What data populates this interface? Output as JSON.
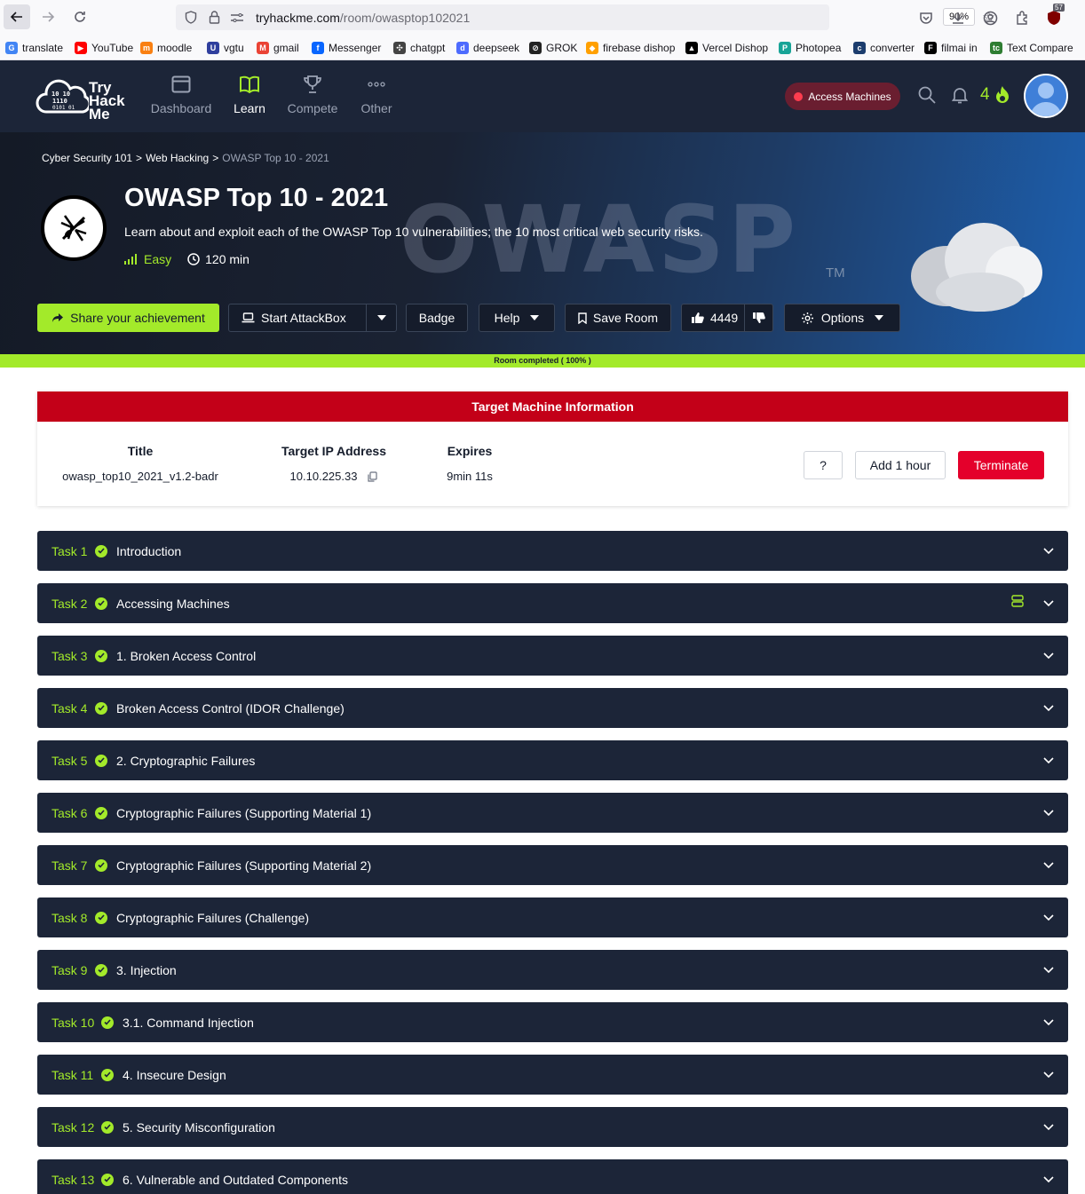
{
  "browser": {
    "url_host": "tryhackme.com",
    "url_path": "/room/owasptop102021",
    "zoom": "90%",
    "extension_badge": "57",
    "bookmarks": [
      {
        "label": "translate",
        "color": "#4285f4",
        "glyph": "G"
      },
      {
        "label": "YouTube",
        "color": "#ff0000",
        "glyph": "▶"
      },
      {
        "label": "moodle",
        "color": "#f98012",
        "glyph": "m"
      },
      {
        "label": "vgtu",
        "color": "#2f3f9e",
        "glyph": "U"
      },
      {
        "label": "gmail",
        "color": "#ea4335",
        "glyph": "M"
      },
      {
        "label": "Messenger",
        "color": "#0866ff",
        "glyph": "f"
      },
      {
        "label": "chatgpt",
        "color": "#444444",
        "glyph": "✣"
      },
      {
        "label": "deepseek",
        "color": "#4d6bfe",
        "glyph": "d"
      },
      {
        "label": "GROK",
        "color": "#222222",
        "glyph": "⊘"
      },
      {
        "label": "firebase dishop",
        "color": "#ffa000",
        "glyph": "◆"
      },
      {
        "label": "Vercel Dishop",
        "color": "#000000",
        "glyph": "▲"
      },
      {
        "label": "Photopea",
        "color": "#18a497",
        "glyph": "P"
      },
      {
        "label": "converter",
        "color": "#1c3d6e",
        "glyph": "c"
      },
      {
        "label": "filmai in",
        "color": "#000000",
        "glyph": "F"
      },
      {
        "label": "Text Compare",
        "color": "#2e7d32",
        "glyph": "tc"
      }
    ]
  },
  "thm": {
    "logo_lines": [
      "Try",
      "Hack",
      "Me"
    ],
    "nav": [
      {
        "label": "Dashboard",
        "icon": "dashboard-icon",
        "active": false
      },
      {
        "label": "Learn",
        "icon": "book-icon",
        "active": true
      },
      {
        "label": "Compete",
        "icon": "trophy-icon",
        "active": false
      },
      {
        "label": "Other",
        "icon": "more-icon",
        "active": false
      }
    ],
    "access_machines": "Access Machines",
    "streak": "4",
    "accent": "#a3ea2a"
  },
  "room": {
    "breadcrumb": [
      "Cyber Security 101",
      "Web Hacking",
      "OWASP Top 10 - 2021"
    ],
    "title": "OWASP Top 10 - 2021",
    "description": "Learn about and exploit each of the OWASP Top 10 vulnerabilities; the 10 most critical web security risks.",
    "difficulty": "Easy",
    "duration": "120 min",
    "watermark": "OWASP",
    "trademark": "TM",
    "actions": {
      "share": "Share your achievement",
      "attackbox": "Start AttackBox",
      "badge": "Badge",
      "help": "Help",
      "save": "Save Room",
      "likes": "4449",
      "options": "Options"
    },
    "progress_text": "Room completed ( 100% )",
    "progress": 1.0
  },
  "target": {
    "header": "Target Machine Information",
    "title_label": "Title",
    "title_value": "owasp_top10_2021_v1.2-badr",
    "ip_label": "Target IP Address",
    "ip_value": "10.10.225.33",
    "expires_label": "Expires",
    "expires_value": "9min 11s",
    "help_btn": "?",
    "add_hour_btn": "Add 1 hour",
    "terminate_btn": "Terminate",
    "danger_color": "#e4002b"
  },
  "tasks": [
    {
      "num": "Task 1",
      "title": "Introduction"
    },
    {
      "num": "Task 2",
      "title": "Accessing Machines"
    },
    {
      "num": "Task 3",
      "title": "1. Broken Access Control"
    },
    {
      "num": "Task 4",
      "title": "Broken Access Control (IDOR Challenge)"
    },
    {
      "num": "Task 5",
      "title": "2. Cryptographic Failures"
    },
    {
      "num": "Task 6",
      "title": "Cryptographic Failures (Supporting Material 1)"
    },
    {
      "num": "Task 7",
      "title": "Cryptographic Failures (Supporting Material 2)"
    },
    {
      "num": "Task 8",
      "title": "Cryptographic Failures (Challenge)"
    },
    {
      "num": "Task 9",
      "title": "3. Injection"
    },
    {
      "num": "Task 10",
      "title": "3.1. Command Injection"
    },
    {
      "num": "Task 11",
      "title": "4. Insecure Design"
    },
    {
      "num": "Task 12",
      "title": "5. Security Misconfiguration"
    },
    {
      "num": "Task 13",
      "title": "6. Vulnerable and Outdated Components"
    }
  ]
}
